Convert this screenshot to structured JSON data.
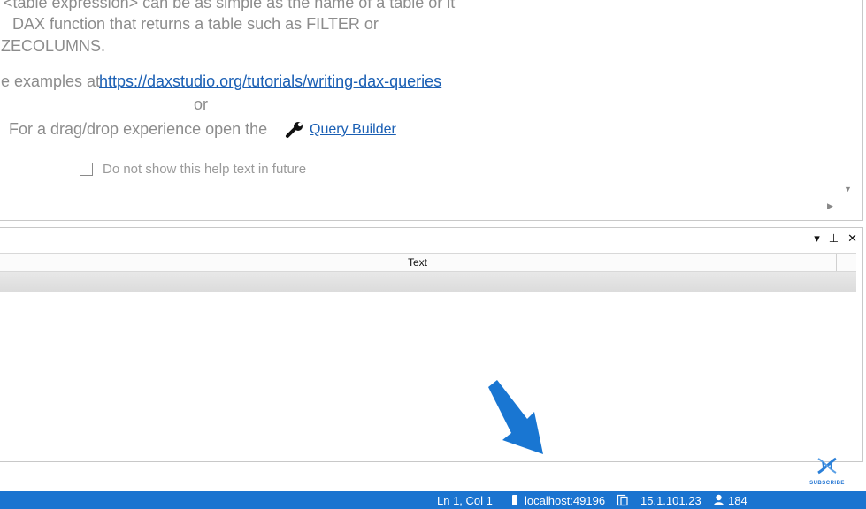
{
  "help": {
    "line1": "<table expression> can be as simple as the name of a table or it",
    "line2": "DAX function that returns a table such as FILTER or",
    "line3": "ZECOLUMNS.",
    "examples_prefix": "e examples at",
    "examples_link": "https://daxstudio.org/tutorials/writing-dax-queries",
    "or": "or",
    "dragdrop_prefix": "For a drag/drop experience open the",
    "query_builder_link": "Query Builder",
    "checkbox_label": "Do not show this help text in future",
    "checkbox_checked": false
  },
  "output_panel": {
    "column_header": "Text",
    "controls": {
      "dropdown": "▾",
      "pin": "⊥",
      "close": "✕"
    }
  },
  "status_bar": {
    "position": "Ln 1, Col 1",
    "server": "localhost:49196",
    "version": "15.1.101.23",
    "user_count": "184",
    "background_color": "#1b74d0"
  },
  "watermark": {
    "subscribe_label": "SUBSCRIBE"
  },
  "annotation": {
    "arrow_color": "#1976d2"
  }
}
